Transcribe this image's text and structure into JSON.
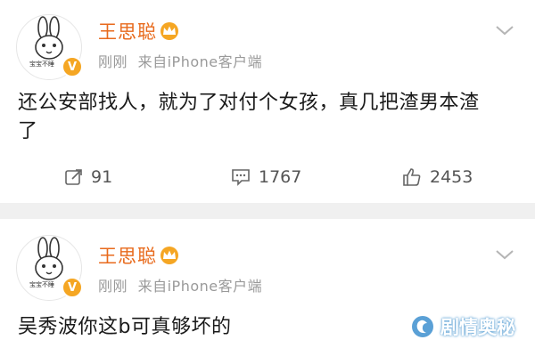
{
  "posts": [
    {
      "avatar_icon": "cartoon-rabbit-avatar-icon",
      "avatar_caption": "宝宝不睡",
      "username": "王思聪",
      "badge_icon": "crown-badge-icon",
      "verified_icon": "verified-v-icon",
      "verified_mark": "V",
      "time": "刚刚",
      "source": "来自iPhone客户端",
      "content_line1": "还公安部找人，就为了对付个女孩，真几把渣男本渣",
      "content_line2": "了",
      "repost_count": "91",
      "comment_count": "1767",
      "like_count": "2453"
    },
    {
      "avatar_icon": "cartoon-rabbit-avatar-icon",
      "avatar_caption": "宝宝不睡",
      "username": "王思聪",
      "badge_icon": "crown-badge-icon",
      "verified_icon": "verified-v-icon",
      "verified_mark": "V",
      "time": "刚刚",
      "source": "来自iPhone客户端",
      "content_line1": "吴秀波你这b可真够坏的"
    }
  ],
  "watermark": {
    "text": "剧情奥秘",
    "logo_icon": "watermark-logo-icon"
  },
  "colors": {
    "username": "#e86a1c",
    "badge": "#f5a623",
    "meta": "#9a9a9a",
    "separator": "#f0f0f0"
  }
}
